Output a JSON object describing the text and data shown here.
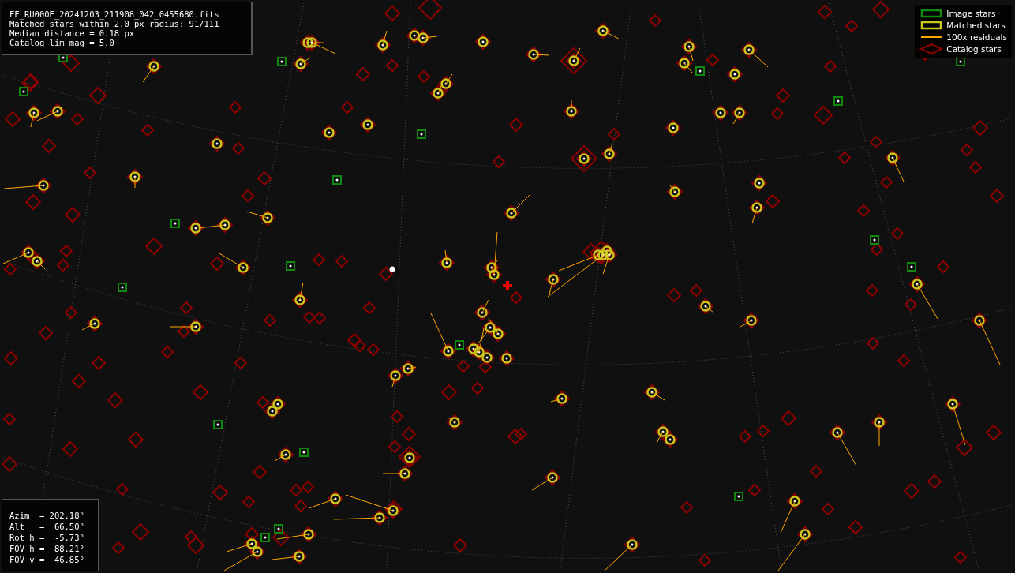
{
  "info_panel": {
    "lines": [
      "FF_RU000E_20241203_211908_042_0455680.fits",
      "Matched stars within 2.0 px radius: 91/111",
      "Median distance = 0.18 px",
      "Catalog lim mag = 5.0"
    ]
  },
  "legend": [
    {
      "kind": "image_box",
      "label": "Image stars",
      "color": "#0f8a0f"
    },
    {
      "kind": "matched_box",
      "label": "Matched stars",
      "color": "#c8c81e"
    },
    {
      "kind": "residual_line",
      "label": "100x residuals",
      "color": "#ffa500"
    },
    {
      "kind": "catalog_diamond",
      "label": "Catalog stars",
      "color": "#8b0000"
    }
  ],
  "pointing_panel": {
    "lines": [
      "Azim  = 202.18°",
      "Alt   =  66.50°",
      "Rot h =  -5.73°",
      "FOV h =  88.21°",
      "FOV v =  46.85°"
    ]
  }
}
